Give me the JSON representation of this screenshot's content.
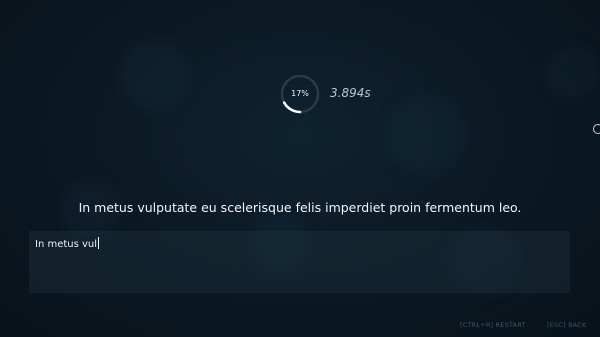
{
  "stats": {
    "progress_percent": 17,
    "progress_label": "17%",
    "elapsed_time": "3.894s"
  },
  "test": {
    "prompt_text": "In metus vulputate eu scelerisque felis imperdiet proin fermentum leo.",
    "typed_text": "In metus vul"
  },
  "shortcuts": {
    "restart": "[CTRL+R] RESTART",
    "back": "[ESC] BACK"
  },
  "colors": {
    "background": "#0b1822",
    "ring_track": "#2a3a47",
    "ring_fill": "#ffffff",
    "input_area": "#1a2c38"
  }
}
